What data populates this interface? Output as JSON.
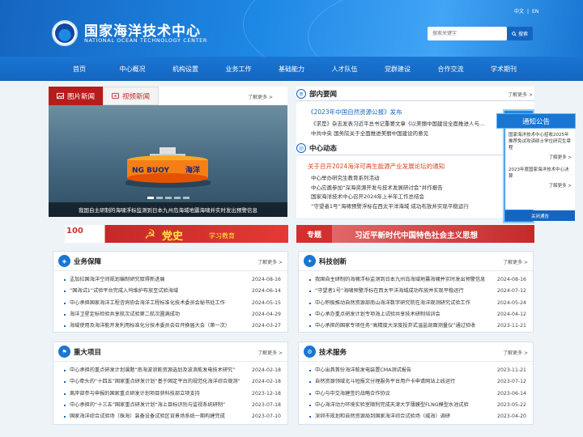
{
  "header": {
    "title": "国家海洋技术中心",
    "subtitle": "NATIONAL OCEAN TECHNOLOGY CENTER",
    "lang_cn": "中文",
    "lang_sep": "|",
    "lang_en": "EN",
    "search_placeholder": "搜索关键字",
    "search_button": "搜索"
  },
  "nav": [
    "首页",
    "中心概况",
    "机构设置",
    "业务工作",
    "基础能力",
    "人才队伍",
    "党群建设",
    "合作交流",
    "学术期刊"
  ],
  "slider": {
    "tab_photo": "图片新闻",
    "tab_video": "视频新闻",
    "more": "了解更多 >",
    "buoy_text": "NG BUOY",
    "buoy_text2": "海洋",
    "caption": "我国自主研制的海啸浮标监测到日本九州岛海域地震海啸并实时发出预警信息"
  },
  "department": {
    "title": "部内要闻",
    "more": "了解更多 >",
    "headline": "《2023年中国自然资源公报》发布",
    "items": [
      "《求是》杂志发表习近平总书记重要文章《以美丽中国建设全面推进人与自然和谐共生的现代化》",
      "中共中央 国务院关于全面推进美丽中国建设的意见"
    ]
  },
  "center": {
    "title": "中心动态",
    "headline": "关于召开2024海洋可再生能源产业发展论坛的通知",
    "items": [
      "中心举办研究生教育系列活动",
      "中心应邀参加“深海资源开发与技术发展研讨会”并作报告",
      "国家海洋技术中心召开2024年上半年工作总结会",
      "“守望者1号”海啸预警浮标在西太平洋海域 成功布放并实现平稳运行"
    ]
  },
  "notice": {
    "title": "通知公告",
    "item1": "国家海洋技术中心招收2025年推荐免试攻读硕士学位研究生章程",
    "more": "了解更多 >",
    "item2": "2023年度国家海洋技术中心决算",
    "close": "关闭通告"
  },
  "banner1": {
    "years": "100",
    "title": "党史",
    "sub": "学习教育"
  },
  "banner2": {
    "tag": "专题",
    "title": "习近平新时代中国特色社会主义思想"
  },
  "business": {
    "title": "业务保障",
    "more": "了解更多 >",
    "rows": [
      {
        "t": "孟加拉国海洋空间规划编制研究取得新进展",
        "d": "2024-08-16"
      },
      {
        "t": "“国海试1”试验平台完成入坞维护布放至试验海域",
        "d": "2024-06-14"
      },
      {
        "t": "中心承担国家海洋工程咨询协会海洋工程标准化技术委员会秘书处工作",
        "d": "2024-05-15"
      },
      {
        "t": "海洋卫星定标检验共享航次试验第二航次圆满成功",
        "d": "2024-04-29"
      },
      {
        "t": "海域使用及海洋能开发利用标准化分技术委员会召开换届大会（第一次）",
        "d": "2024-03-27"
      }
    ]
  },
  "innovation": {
    "title": "科技创新",
    "more": "了解更多 >",
    "rows": [
      {
        "t": "我国自主研制的海啸浮标监测到日本九州岛海域地震海啸并实时发出预警信息",
        "d": "2024-08-16"
      },
      {
        "t": "“守望者1号”海啸预警浮标在西太平洋海域成功布放并实现平稳运行",
        "d": "2024-07-12"
      },
      {
        "t": "中心积极推动自然资源部南山海洋数字研究院在海洋观测研究试验工作",
        "d": "2024-05-24"
      },
      {
        "t": "中心承办重点研发计划专项海上试验共享技术研制培训会",
        "d": "2024-04-12"
      },
      {
        "t": "中心承担的国家专项任务“高精度大深度投弃式温盐剖面测量仪”通过验收",
        "d": "2023-11-21"
      }
    ]
  },
  "projects": {
    "title": "重大项目",
    "more": "了解更多 >",
    "rows": [
      {
        "t": "中心承担的重点研发计划课题“南海波浪能资源选划及波浪能发电技术研究”",
        "d": "2024-02-18"
      },
      {
        "t": "中心牵头的“十四五”国家重点研发计划“基于固定平台的规范化海洋综合观测”",
        "d": "2024-02-18"
      },
      {
        "t": "离岸部参与申报的国家重点研发计划项目获科技部立项支持",
        "d": "2023-12-18"
      },
      {
        "t": "中心承担的“十三五”国家重点研发计划“海上目标识别与监视系统研制”",
        "d": "2023-07-18"
      },
      {
        "t": "国家海洋综合试验场（珠海）装备设备试验区背景场系统一期构建完成",
        "d": "2023-07-10"
      }
    ]
  },
  "services": {
    "title": "技术服务",
    "more": "了解更多 >",
    "rows": [
      {
        "t": "中心出具首份海洋能发电装置CMA测试报告",
        "d": "2023-11-21"
      },
      {
        "t": "自然资源领域北斗短报文分理服务平台用户卡申请网站上线运行",
        "d": "2023-07-12"
      },
      {
        "t": "中心与中交海建签约战略合作协议",
        "d": "2023-06-14"
      },
      {
        "t": "中心海洋动力环境实验室顺利完成天津大学薄膜型FLNG模型水池试验",
        "d": "2023-05-22"
      },
      {
        "t": "深圳市规划和自然资源局到国家海洋综合试验场（威海）调研",
        "d": "2023-04-20"
      }
    ]
  },
  "colors": {
    "primary": "#1565c0",
    "red": "#b71c1c",
    "orange": "#d84315"
  }
}
